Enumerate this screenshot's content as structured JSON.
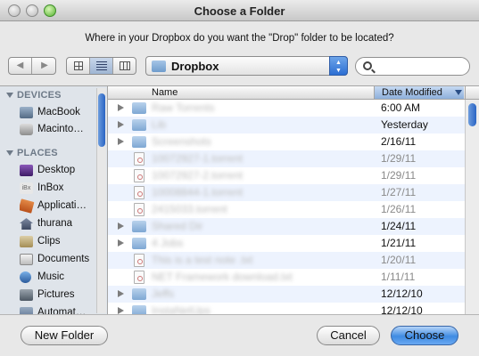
{
  "window": {
    "title": "Choose a Folder"
  },
  "prompt": "Where in your Dropbox do you want the \"Drop\" folder to be located?",
  "toolbar": {
    "location": "Dropbox",
    "search_value": ""
  },
  "sidebar": {
    "devices_label": "DEVICES",
    "devices": [
      {
        "label": "MacBook",
        "icon": "laptop-icon"
      },
      {
        "label": "Macinto…",
        "icon": "hard-disk-icon"
      }
    ],
    "places_label": "PLACES",
    "places": [
      {
        "label": "Desktop",
        "icon": "desktop-icon"
      },
      {
        "label": "InBox",
        "icon": "inbox-icon"
      },
      {
        "label": "Applicati…",
        "icon": "applications-icon"
      },
      {
        "label": "thurana",
        "icon": "home-icon"
      },
      {
        "label": "Clips",
        "icon": "folder-icon"
      },
      {
        "label": "Documents",
        "icon": "documents-icon"
      },
      {
        "label": "Music",
        "icon": "music-icon"
      },
      {
        "label": "Pictures",
        "icon": "pictures-icon"
      },
      {
        "label": "Automat…",
        "icon": "folder-icon"
      }
    ]
  },
  "columns": {
    "name": "Name",
    "date_modified": "Date Modified"
  },
  "files": [
    {
      "name": "Raw Torrents",
      "date": "6:00 AM",
      "type": "folder",
      "dim": false
    },
    {
      "name": "Lib",
      "date": "Yesterday",
      "type": "folder",
      "dim": false
    },
    {
      "name": "Screenshots",
      "date": "2/16/11",
      "type": "folder",
      "dim": false
    },
    {
      "name": "10072927-1.torrent",
      "date": "1/29/11",
      "type": "file",
      "dim": true
    },
    {
      "name": "10072927-2.torrent",
      "date": "1/29/11",
      "type": "file",
      "dim": true
    },
    {
      "name": "10008844-1.torrent",
      "date": "1/27/11",
      "type": "file",
      "dim": true
    },
    {
      "name": "2415033.torrent",
      "date": "1/26/11",
      "type": "file",
      "dim": true
    },
    {
      "name": "Shared Dir",
      "date": "1/24/11",
      "type": "folder",
      "dim": false
    },
    {
      "name": "4 Jobs",
      "date": "1/21/11",
      "type": "folder",
      "dim": false
    },
    {
      "name": "This is a test note .txt",
      "date": "1/20/11",
      "type": "file",
      "dim": true
    },
    {
      "name": "NET Framework download.txt",
      "date": "1/11/11",
      "type": "file",
      "dim": true
    },
    {
      "name": "Jeffs",
      "date": "12/12/10",
      "type": "folder",
      "dim": false
    },
    {
      "name": "InstaNetUps",
      "date": "12/12/10",
      "type": "folder",
      "dim": false
    }
  ],
  "buttons": {
    "new_folder": "New Folder",
    "cancel": "Cancel",
    "choose": "Choose"
  }
}
